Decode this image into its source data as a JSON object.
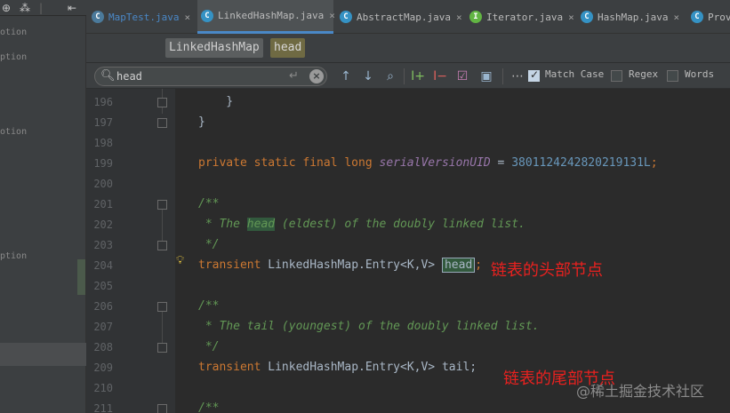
{
  "left_panel": {
    "toolbar": [
      "⊕",
      "⁂",
      "|",
      "⇤"
    ],
    "items": [
      {
        "text": "otion"
      },
      {
        "text": "ption"
      },
      {
        "text": "otion"
      },
      {
        "text": "ption"
      }
    ]
  },
  "tabs": [
    {
      "label": "MapTest.java",
      "icon": "C",
      "active": false,
      "close": "×"
    },
    {
      "label": "LinkedHashMap.java",
      "icon": "C",
      "active": true,
      "close": "×"
    },
    {
      "label": "AbstractMap.java",
      "icon": "C",
      "active": false,
      "close": "×"
    },
    {
      "label": "Iterator.java",
      "icon": "I",
      "active": false,
      "close": "×"
    },
    {
      "label": "HashMap.java",
      "icon": "C",
      "active": false,
      "close": "×"
    },
    {
      "label": "Prov",
      "icon": "C",
      "active": false,
      "close": ""
    }
  ],
  "breadcrumb": {
    "class_name": "LinkedHashMap",
    "member": "head"
  },
  "find": {
    "query": "head",
    "match_case_label": "Match Case",
    "match_case_checked": true,
    "regex_label": "Regex",
    "regex_checked": false,
    "words_label": "Words",
    "words_checked": false
  },
  "lines": [
    {
      "n": "196"
    },
    {
      "n": "197"
    },
    {
      "n": "198"
    },
    {
      "n": "199"
    },
    {
      "n": "200"
    },
    {
      "n": "201"
    },
    {
      "n": "202"
    },
    {
      "n": "203"
    },
    {
      "n": "204"
    },
    {
      "n": "205"
    },
    {
      "n": "206"
    },
    {
      "n": "207"
    },
    {
      "n": "208"
    },
    {
      "n": "209"
    },
    {
      "n": "210"
    },
    {
      "n": "211"
    }
  ],
  "code": {
    "l196": "    }",
    "l197": "}",
    "l199_kw": "private static final long ",
    "l199_var": "serialVersionUID",
    "l199_eq": " = ",
    "l199_num": "3801124242820219131L",
    "l199_semi": ";",
    "l201": "/**",
    "l202_pre": " * The ",
    "l202_match": "head",
    "l202_post": " (eldest) of the doubly linked list.",
    "l203": " */",
    "l204_kw": "transient ",
    "l204_type": "LinkedHashMap.Entry",
    "l204_gen": "<K,V>",
    "l204_sp": " ",
    "l204_match": "head",
    "l204_semi": ";",
    "l206": "/**",
    "l207": " * The tail (youngest) of the doubly linked list.",
    "l208": " */",
    "l209_kw": "transient ",
    "l209_type": "LinkedHashMap.Entry",
    "l209_gen": "<K,V>",
    "l209_rest": " tail;",
    "l211": "/**"
  },
  "annotations": {
    "head_note": "链表的头部节点",
    "tail_note": "链表的尾部节点"
  },
  "watermark": "@稀土掘金技术社区"
}
